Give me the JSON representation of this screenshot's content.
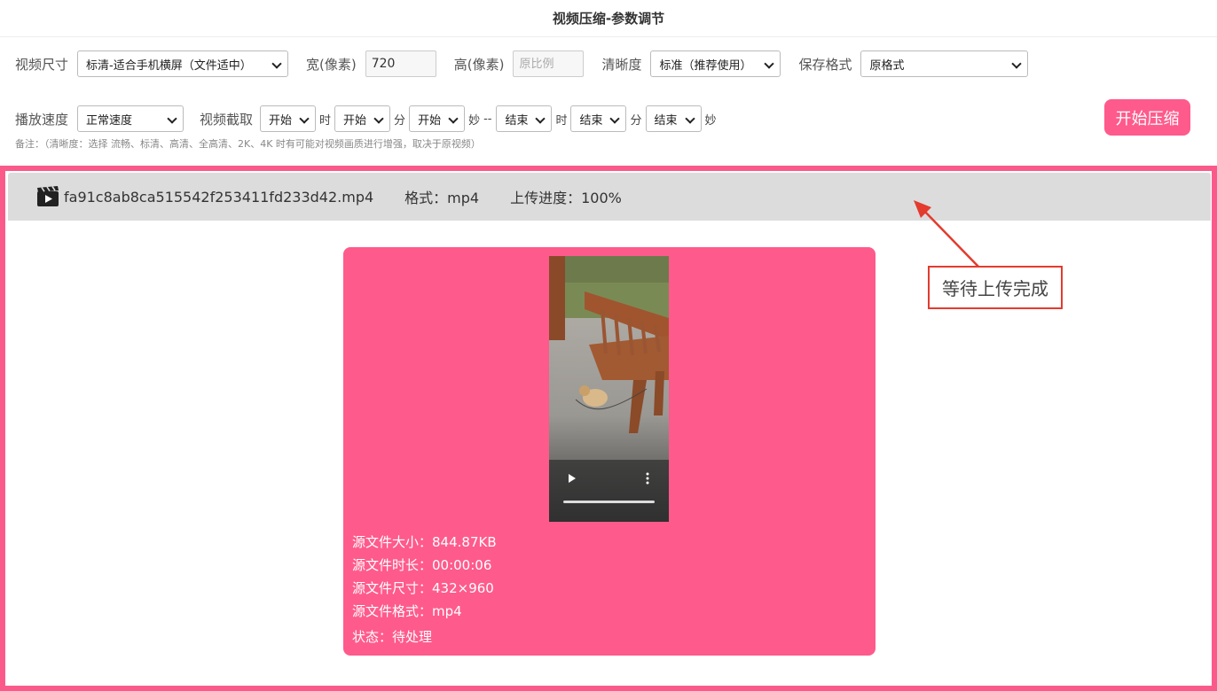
{
  "page": {
    "title": "视频压缩-参数调节"
  },
  "settings": {
    "video_size_label": "视频尺寸",
    "video_size_value": "标清-适合手机横屏（文件适中）",
    "width_label": "宽(像素)",
    "width_value": "720",
    "height_label": "高(像素)",
    "height_placeholder": "原比例",
    "clarity_label": "清晰度",
    "clarity_value": "标准（推荐使用）",
    "format_label": "保存格式",
    "format_value": "原格式",
    "speed_label": "播放速度",
    "speed_value": "正常速度",
    "clip_label": "视频截取",
    "start_h": "开始",
    "start_m": "开始",
    "start_s": "开始",
    "end_h": "结束",
    "end_m": "结束",
    "end_s": "结束",
    "unit_h": "时",
    "unit_m": "分",
    "unit_s": "妙",
    "separator": "--",
    "start_button": "开始压缩",
    "note": "备注：（清晰度：选择 流畅、标清、高清、全高清、2K、4K 时有可能对视频画质进行增强，取决于原视频）"
  },
  "file": {
    "icon": "video-file-icon",
    "name": "fa91c8ab8ca515542f253411fd233d42.mp4",
    "format": "格式：mp4",
    "progress_text": "上传进度：100%",
    "progress": 1.0
  },
  "card": {
    "size": "源文件大小：844.87KB",
    "duration": "源文件时长：00:00:06",
    "dimensions": "源文件尺寸：432×960",
    "format": "源文件格式：mp4",
    "status": "状态：待处理"
  },
  "annotation": {
    "text": "等待上传完成",
    "color": "#e33b2e"
  },
  "colors": {
    "accent": "#ff5a8c",
    "panel_border": "#fa5a8a",
    "file_bar": "#dcdcdc"
  }
}
